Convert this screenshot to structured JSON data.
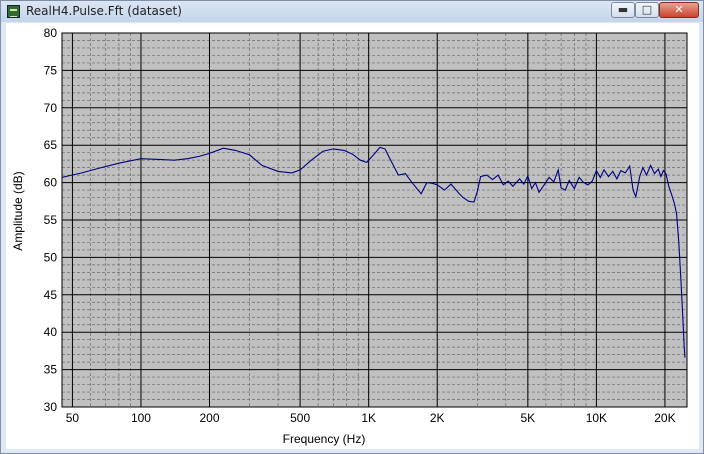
{
  "window": {
    "title": "RealH4.Pulse.Fft (dataset)",
    "minimize_glyph": "▬",
    "maximize_glyph": "□",
    "close_glyph": "✕"
  },
  "chart_data": {
    "type": "line",
    "xlabel": "Frequency (Hz)",
    "ylabel": "Amplitude (dB)",
    "xscale": "log",
    "xlim": [
      45,
      25000
    ],
    "ylim": [
      30,
      80
    ],
    "grid": true,
    "background": "#c0c0c0",
    "line_color": "#000080",
    "x_ticks": [
      {
        "value": 50,
        "label": "50"
      },
      {
        "value": 100,
        "label": "100"
      },
      {
        "value": 200,
        "label": "200"
      },
      {
        "value": 500,
        "label": "500"
      },
      {
        "value": 1000,
        "label": "1K"
      },
      {
        "value": 2000,
        "label": "2K"
      },
      {
        "value": 5000,
        "label": "5K"
      },
      {
        "value": 10000,
        "label": "10K"
      },
      {
        "value": 20000,
        "label": "20K"
      }
    ],
    "y_ticks": [
      {
        "value": 80,
        "label": "80"
      },
      {
        "value": 75,
        "label": "75"
      },
      {
        "value": 70,
        "label": "70"
      },
      {
        "value": 65,
        "label": "65"
      },
      {
        "value": 60,
        "label": "60"
      },
      {
        "value": 55,
        "label": "55"
      },
      {
        "value": 50,
        "label": "50"
      },
      {
        "value": 45,
        "label": "45"
      },
      {
        "value": 40,
        "label": "40"
      },
      {
        "value": 35,
        "label": "35"
      },
      {
        "value": 30,
        "label": "30"
      }
    ],
    "series": [
      {
        "points": [
          [
            45,
            60.7
          ],
          [
            55,
            61.3
          ],
          [
            65,
            61.9
          ],
          [
            80,
            62.6
          ],
          [
            100,
            63.2
          ],
          [
            120,
            63.1
          ],
          [
            140,
            63.0
          ],
          [
            160,
            63.2
          ],
          [
            180,
            63.5
          ],
          [
            200,
            63.9
          ],
          [
            230,
            64.6
          ],
          [
            260,
            64.3
          ],
          [
            300,
            63.7
          ],
          [
            340,
            62.3
          ],
          [
            400,
            61.5
          ],
          [
            460,
            61.3
          ],
          [
            500,
            61.7
          ],
          [
            560,
            63.0
          ],
          [
            630,
            64.2
          ],
          [
            700,
            64.5
          ],
          [
            780,
            64.3
          ],
          [
            850,
            63.8
          ],
          [
            920,
            63.0
          ],
          [
            980,
            62.7
          ],
          [
            1050,
            63.7
          ],
          [
            1120,
            64.7
          ],
          [
            1180,
            64.5
          ],
          [
            1250,
            63.0
          ],
          [
            1350,
            61.0
          ],
          [
            1450,
            61.2
          ],
          [
            1550,
            60.0
          ],
          [
            1700,
            58.5
          ],
          [
            1800,
            60.0
          ],
          [
            1900,
            59.9
          ],
          [
            2000,
            59.7
          ],
          [
            2150,
            59.0
          ],
          [
            2300,
            59.8
          ],
          [
            2500,
            58.5
          ],
          [
            2600,
            58.0
          ],
          [
            2750,
            57.5
          ],
          [
            2900,
            57.4
          ],
          [
            3000,
            58.8
          ],
          [
            3100,
            60.8
          ],
          [
            3300,
            61.0
          ],
          [
            3500,
            60.4
          ],
          [
            3700,
            61.0
          ],
          [
            3900,
            59.7
          ],
          [
            4100,
            60.2
          ],
          [
            4300,
            59.5
          ],
          [
            4600,
            60.5
          ],
          [
            4800,
            59.8
          ],
          [
            5000,
            60.9
          ],
          [
            5200,
            59.2
          ],
          [
            5400,
            60.0
          ],
          [
            5600,
            58.7
          ],
          [
            5900,
            59.7
          ],
          [
            6200,
            60.7
          ],
          [
            6500,
            60.1
          ],
          [
            6800,
            61.7
          ],
          [
            7000,
            59.3
          ],
          [
            7300,
            59.0
          ],
          [
            7600,
            60.3
          ],
          [
            8000,
            59.2
          ],
          [
            8400,
            60.7
          ],
          [
            8800,
            60.0
          ],
          [
            9200,
            59.7
          ],
          [
            9600,
            60.2
          ],
          [
            10000,
            61.6
          ],
          [
            10400,
            60.7
          ],
          [
            10800,
            61.7
          ],
          [
            11300,
            60.8
          ],
          [
            11800,
            61.5
          ],
          [
            12300,
            60.5
          ],
          [
            12800,
            61.6
          ],
          [
            13400,
            61.3
          ],
          [
            14000,
            62.2
          ],
          [
            14500,
            59.0
          ],
          [
            14900,
            58.1
          ],
          [
            15500,
            60.8
          ],
          [
            16000,
            62.0
          ],
          [
            16600,
            61.0
          ],
          [
            17300,
            62.3
          ],
          [
            18000,
            61.2
          ],
          [
            18700,
            61.8
          ],
          [
            19200,
            60.8
          ],
          [
            19700,
            61.6
          ],
          [
            20200,
            61.2
          ],
          [
            20800,
            59.5
          ],
          [
            21400,
            58.4
          ],
          [
            22000,
            57.2
          ],
          [
            22500,
            55.8
          ],
          [
            23000,
            52.0
          ],
          [
            23500,
            47.0
          ],
          [
            24000,
            41.5
          ],
          [
            24300,
            38.0
          ],
          [
            24500,
            36.6
          ]
        ]
      }
    ]
  }
}
